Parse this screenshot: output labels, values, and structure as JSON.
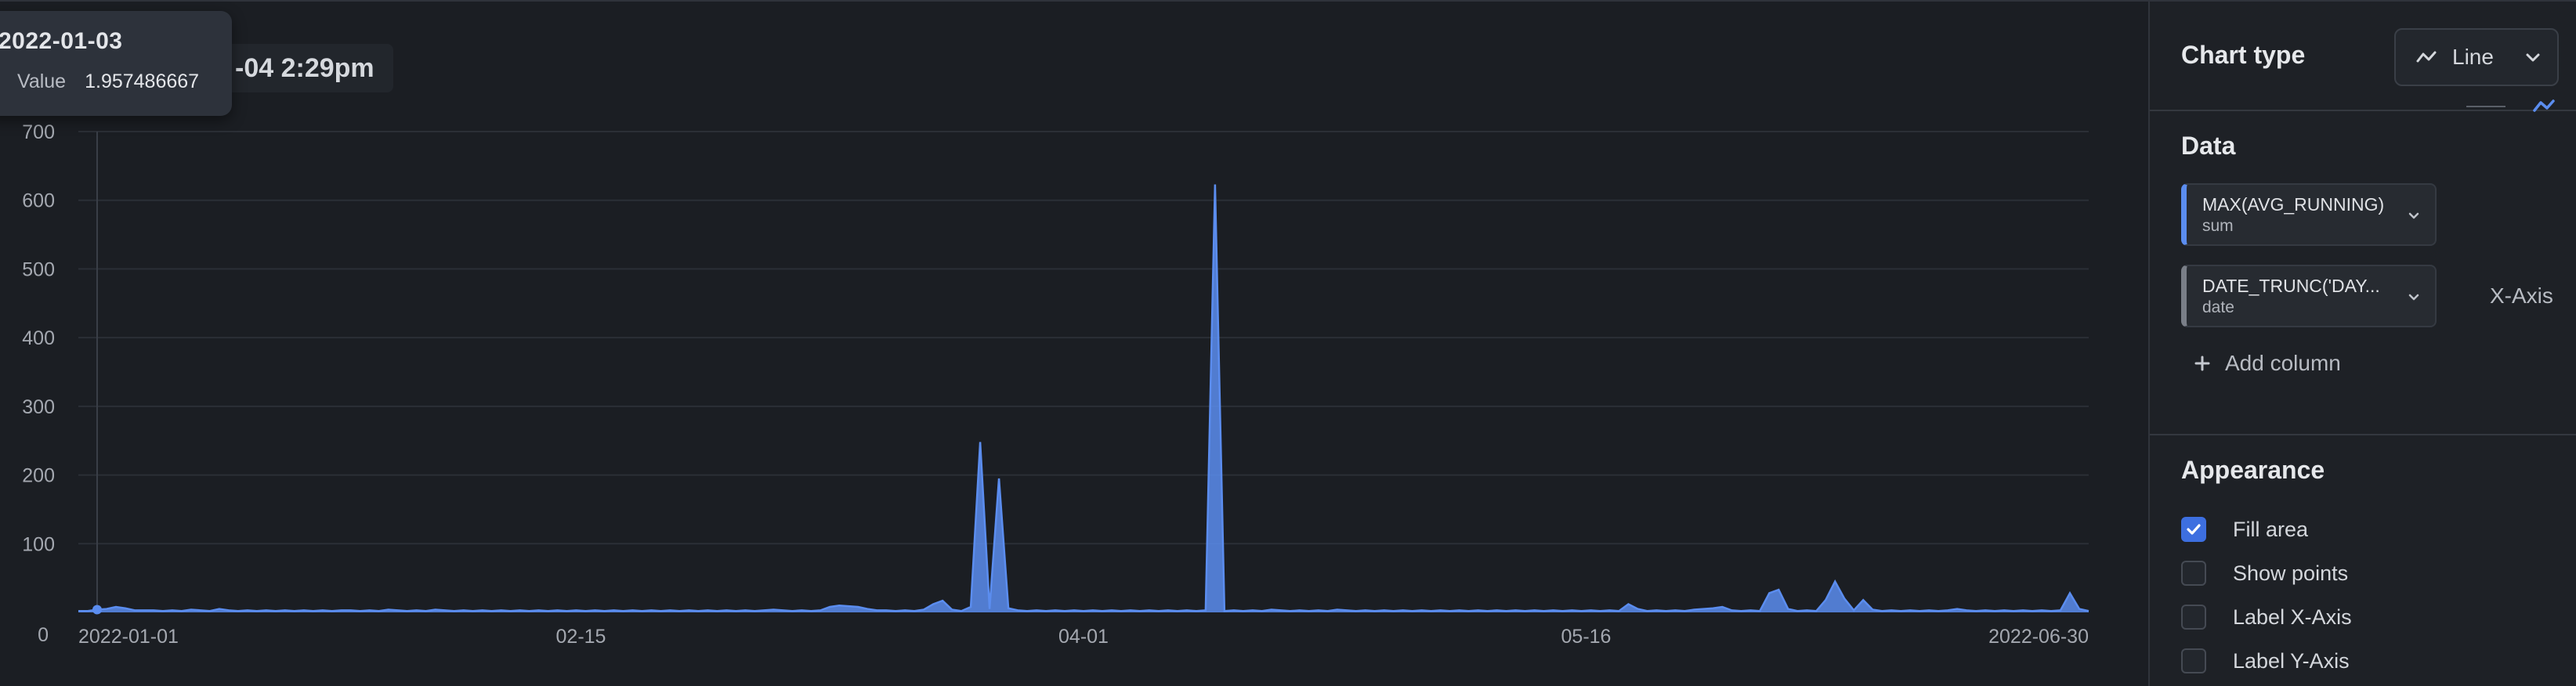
{
  "chart": {
    "title_visible": "-04 2:29pm",
    "tooltip": {
      "date": "2022-01-03",
      "label": "Value",
      "value": "1.957486667"
    },
    "y_ticks": [
      "0",
      "100",
      "200",
      "300",
      "400",
      "500",
      "600",
      "700"
    ],
    "x_ticks": [
      "2022-01-01",
      "02-15",
      "04-01",
      "05-16",
      "2022-06-30"
    ]
  },
  "panel": {
    "chart_type_label": "Chart type",
    "chart_type_value": "Line",
    "data_title": "Data",
    "y_column": {
      "name": "MAX(AVG_RUNNING)",
      "agg": "sum"
    },
    "x_column": {
      "name": "DATE_TRUNC('DAY...",
      "agg": "date"
    },
    "x_axis_label": "X-Axis",
    "add_column_label": "Add column",
    "appearance_title": "Appearance",
    "options": [
      {
        "label": "Fill area",
        "checked": true
      },
      {
        "label": "Show points",
        "checked": false
      },
      {
        "label": "Label X-Axis",
        "checked": false
      },
      {
        "label": "Label Y-Axis",
        "checked": false
      }
    ]
  },
  "colors": {
    "series": "#5b8def",
    "accent": "#3d6fe0"
  },
  "chart_data": {
    "type": "area",
    "ylim": [
      0,
      700
    ],
    "x_start": "2022-01-01",
    "x_end": "2022-06-30",
    "x_tick_dates": [
      "2022-01-01",
      "2022-02-15",
      "2022-04-01",
      "2022-05-16",
      "2022-06-30"
    ],
    "series": [
      {
        "values": [
          2,
          2,
          4,
          5,
          8,
          6,
          3,
          3,
          3,
          2,
          3,
          2,
          4,
          3,
          2,
          5,
          3,
          2,
          3,
          2,
          3,
          2,
          3,
          2,
          3,
          2,
          3,
          2,
          3,
          3,
          2,
          3,
          2,
          4,
          3,
          2,
          3,
          2,
          4,
          3,
          2,
          3,
          2,
          3,
          2,
          3,
          2,
          3,
          2,
          3,
          2,
          3,
          2,
          3,
          2,
          3,
          2,
          3,
          2,
          3,
          2,
          3,
          2,
          3,
          2,
          3,
          2,
          3,
          2,
          3,
          2,
          3,
          2,
          3,
          4,
          3,
          2,
          3,
          2,
          3,
          8,
          10,
          9,
          8,
          5,
          3,
          3,
          2,
          3,
          2,
          4,
          12,
          17,
          4,
          2,
          8,
          248,
          5,
          195,
          6,
          3,
          2,
          3,
          2,
          3,
          2,
          3,
          2,
          3,
          2,
          3,
          2,
          3,
          2,
          3,
          2,
          3,
          2,
          3,
          2,
          3,
          623,
          2,
          3,
          2,
          3,
          2,
          4,
          3,
          2,
          3,
          2,
          3,
          2,
          4,
          3,
          2,
          3,
          2,
          3,
          2,
          3,
          2,
          3,
          2,
          3,
          2,
          3,
          2,
          3,
          2,
          3,
          2,
          3,
          2,
          3,
          2,
          3,
          2,
          3,
          2,
          3,
          2,
          3,
          2,
          12,
          5,
          2,
          3,
          2,
          3,
          2,
          4,
          5,
          6,
          8,
          3,
          2,
          3,
          2,
          28,
          33,
          5,
          2,
          3,
          2,
          18,
          45,
          20,
          3,
          18,
          4,
          2,
          3,
          2,
          3,
          2,
          3,
          2,
          3,
          5,
          3,
          2,
          3,
          2,
          3,
          2,
          3,
          2,
          3,
          2,
          3,
          28,
          5,
          2
        ]
      }
    ]
  }
}
